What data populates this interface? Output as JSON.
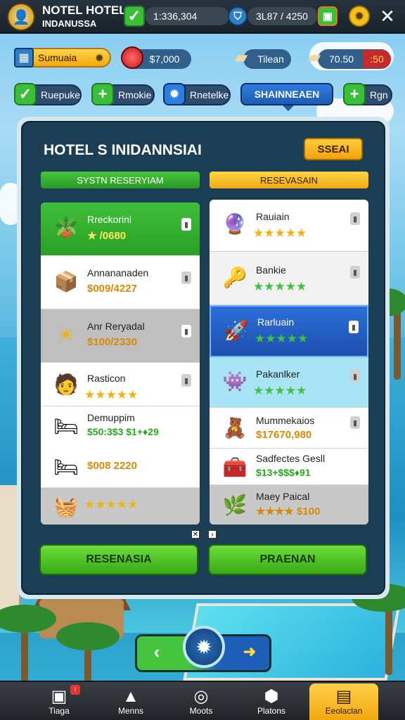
{
  "header": {
    "title": "NOTEL HOTEL",
    "subtitle": "INDANUSSA",
    "stat_primary": "1:336,304",
    "stat_secondary": "3L87 / 4250",
    "close_label": "✕"
  },
  "resources": {
    "location_label": "Sumuaia",
    "money_value": "$7,000",
    "ticket_label": "Tilean",
    "ticket_value": "70.50",
    "ticket_badge": ":50"
  },
  "tabs": [
    {
      "label": "Ruepuke",
      "icon": "check-icon",
      "color": "#3bbf3b"
    },
    {
      "label": "Rmokie",
      "icon": "plus-icon",
      "color": "#3bbf3b"
    },
    {
      "label": "Rnetelke",
      "icon": "gear-icon",
      "color": "#2b7de0"
    },
    {
      "label": "SHAINNEAEN",
      "icon": "",
      "color": "#2b7de0"
    },
    {
      "label": "Rgn",
      "icon": "plus-icon",
      "color": "#3bbf3b"
    }
  ],
  "panel": {
    "title": "HOTEL S INIDANNSIAI",
    "action_label": "SSEAI",
    "left_header": "SYSTN RESERYIAM",
    "right_header": "RESEVASAIN",
    "left_items": [
      {
        "name": "Rreckorini",
        "value": "★ /0680",
        "icon": "plant-icon",
        "emoji": "🪴"
      },
      {
        "name": "Annananaden",
        "value": "$009/4227",
        "icon": "box-icon",
        "emoji": "📦"
      },
      {
        "name": "Anr Reryadal",
        "value": "$100/2330",
        "icon": "sun-icon",
        "emoji": "☀"
      },
      {
        "name": "Rasticon",
        "value": "★★★★★",
        "icon": "character-icon",
        "emoji": "🧑"
      },
      {
        "name": "Demuppim",
        "value": "$50:3$3 $1+♦29",
        "icon": "bed-icon",
        "emoji": "🛏"
      },
      {
        "name": "",
        "value": "$008 2220",
        "icon": "bed-icon",
        "emoji": "🛏"
      },
      {
        "name": "",
        "value": "★★★★★",
        "icon": "basket-icon",
        "emoji": "🧺"
      }
    ],
    "right_items": [
      {
        "name": "Rauiain",
        "value": "★★★★★",
        "icon": "globe-icon",
        "emoji": "🔮"
      },
      {
        "name": "Bankie",
        "value": "★★★★★",
        "icon": "key-icon",
        "emoji": "🔑"
      },
      {
        "name": "Rarluain",
        "value": "★★★★★",
        "icon": "rocket-icon",
        "emoji": "🚀"
      },
      {
        "name": "Pakanlker",
        "value": "★★★★★",
        "icon": "monster-icon",
        "emoji": "👾"
      },
      {
        "name": "Mummekaios",
        "value": "$17670,980",
        "icon": "bear-icon",
        "emoji": "🧸"
      },
      {
        "name": "Sadfectes Gesll",
        "value": "$13+$$$♦91",
        "icon": "chest-icon",
        "emoji": "🧰"
      },
      {
        "name": "Maey Paical",
        "value": "★★★★ $100",
        "icon": "leaf-icon",
        "emoji": "🌿"
      }
    ],
    "left_button": "RESENASIA",
    "right_button": "PRAENAN"
  },
  "bottom_nav": [
    {
      "label": "Tiaga",
      "icon": "card-icon",
      "glyph": "▣"
    },
    {
      "label": "Menns",
      "icon": "building-icon",
      "glyph": "▲"
    },
    {
      "label": "Moots",
      "icon": "globe-icon",
      "glyph": "◎"
    },
    {
      "label": "Platons",
      "icon": "cube-icon",
      "glyph": "⬢"
    },
    {
      "label": "Eeolaclan",
      "icon": "briefcase-icon",
      "glyph": "▤"
    }
  ],
  "colors": {
    "panel_bg": "#1b3e55",
    "accent_green": "#3bbf3b",
    "accent_yellow": "#f2a90e",
    "accent_blue": "#2b7de0"
  }
}
